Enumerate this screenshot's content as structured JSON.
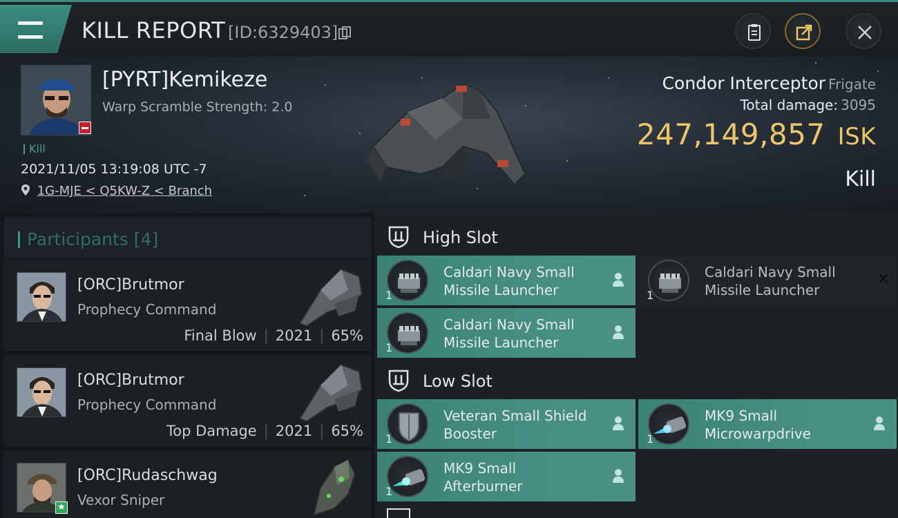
{
  "header": {
    "title": "KILL REPORT",
    "report_id": "[ID:6329403]"
  },
  "victim": {
    "pilot_name": "[PYRT]Kemikeze",
    "warp_scramble": "Warp Scramble Strength: 2.0",
    "result_tag": "Kill",
    "datetime": "2021/11/05 13:19:08 UTC -7",
    "location": "1G-MJE < Q5KW-Z < Branch",
    "ship_name": "Condor Interceptor",
    "ship_class": "Frigate",
    "total_damage_label": "Total damage:",
    "total_damage_value": "3095",
    "isk_value": "247,149,857",
    "isk_unit": "ISK",
    "kill_label": "Kill"
  },
  "participants": {
    "title": "Participants [4]",
    "rows": [
      {
        "name": "[ORC]Brutmor",
        "ship": "Prophecy Command",
        "role": "Final Blow",
        "damage": "2021",
        "percent": "65%"
      },
      {
        "name": "[ORC]Brutmor",
        "ship": "Prophecy Command",
        "role": "Top Damage",
        "damage": "2021",
        "percent": "65%"
      },
      {
        "name": "[ORC]Rudaschwag",
        "ship": "Vexor Sniper",
        "role": "",
        "damage": "",
        "percent": ""
      }
    ]
  },
  "fitting": {
    "high_slot_title": "High Slot",
    "low_slot_title": "Low Slot",
    "high_slot": [
      {
        "name_line1": "Caldari Navy Small",
        "name_line2": "Missile Launcher",
        "qty": "1",
        "state": "fitted"
      },
      {
        "name_line1": "Caldari Navy Small",
        "name_line2": "Missile Launcher",
        "qty": "1",
        "state": "dropped"
      },
      {
        "name_line1": "Caldari Navy Small",
        "name_line2": "Missile Launcher",
        "qty": "1",
        "state": "fitted"
      }
    ],
    "low_slot": [
      {
        "name_line1": "Veteran Small Shield",
        "name_line2": "Booster",
        "qty": "1",
        "state": "fitted"
      },
      {
        "name_line1": "MK9 Small",
        "name_line2": "Microwarpdrive",
        "qty": "1",
        "state": "fitted"
      },
      {
        "name_line1": "MK9 Small",
        "name_line2": "Afterburner",
        "qty": "1",
        "state": "fitted"
      }
    ]
  },
  "colors": {
    "accent_teal": "#3a8176",
    "isk_gold": "#f0c56a",
    "badge_red": "#c8202a",
    "badge_green": "#2fa65a"
  },
  "icons": {
    "menu": "hamburger-icon",
    "copy": "copy-icon",
    "clipboard": "clipboard-icon",
    "share": "share-icon",
    "close": "close-icon",
    "location": "location-pin-icon",
    "slot": "slot-shield-icon",
    "pilot": "pilot-person-icon"
  }
}
